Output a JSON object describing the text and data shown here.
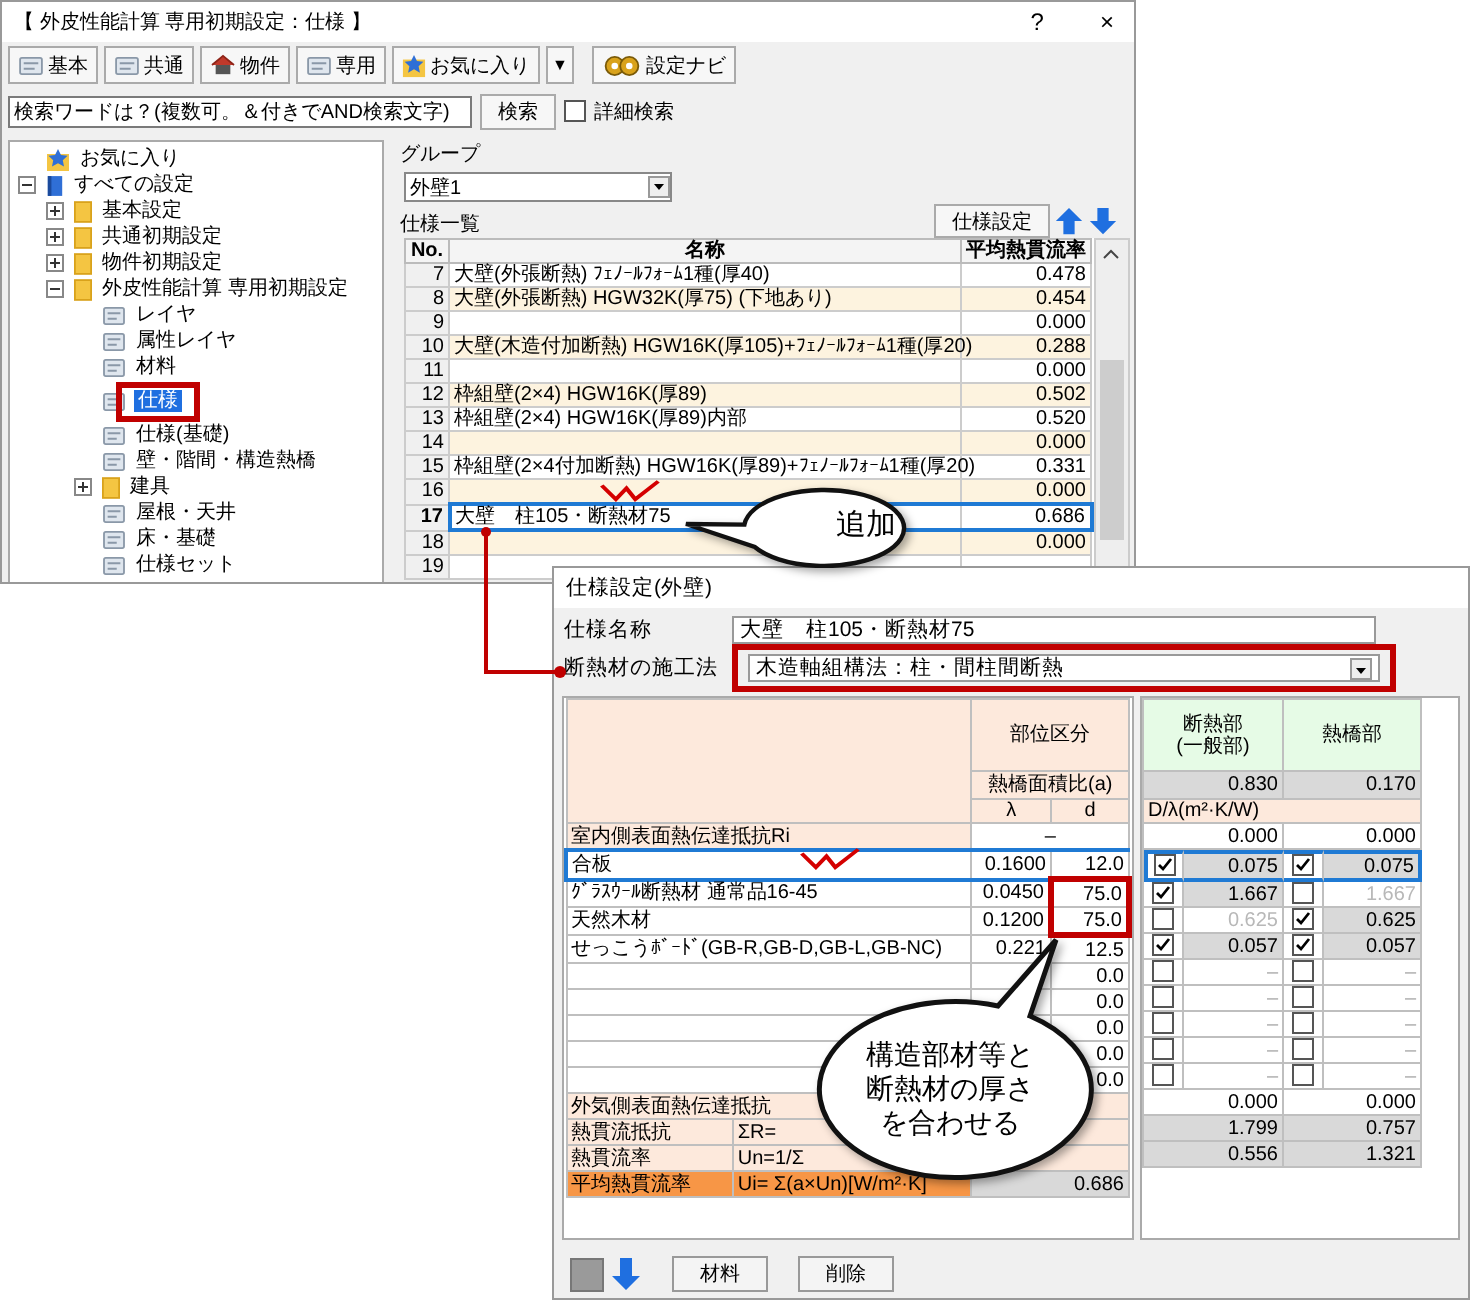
{
  "main_window": {
    "title": "【 外皮性能計算 専用初期設定：仕様 】",
    "help": "?",
    "close": "×"
  },
  "toolbar": [
    {
      "kind": "doc",
      "label": "基本"
    },
    {
      "kind": "doc",
      "label": "共通"
    },
    {
      "kind": "house",
      "label": "物件"
    },
    {
      "kind": "doc",
      "label": "専用"
    },
    {
      "kind": "star",
      "label": "お気に入り"
    },
    {
      "kind": "dropdown",
      "label": "▼"
    },
    {
      "kind": "gear",
      "label": "設定ナビ"
    }
  ],
  "search": {
    "value": "検索ワードは？(複数可。＆付きでAND検索文字)",
    "button": "検索",
    "detail_label": "詳細検索",
    "detail_checked": false
  },
  "tree": [
    {
      "kind": "star",
      "label": "お気に入り",
      "selected": false,
      "highlighted": false
    },
    {
      "kind": "book",
      "label": "すべての設定",
      "selected": false,
      "highlighted": false,
      "expanded": true,
      "children": [
        {
          "kind": "folder",
          "label": "基本設定",
          "selected": false,
          "highlighted": false,
          "expanded": false
        },
        {
          "kind": "folder",
          "label": "共通初期設定",
          "selected": false,
          "highlighted": false,
          "expanded": false
        },
        {
          "kind": "folder",
          "label": "物件初期設定",
          "selected": false,
          "highlighted": false,
          "expanded": false
        },
        {
          "kind": "folder",
          "label": "外皮性能計算 専用初期設定",
          "selected": false,
          "highlighted": false,
          "expanded": true,
          "children": [
            {
              "kind": "doc",
              "label": "レイヤ",
              "selected": false,
              "highlighted": false
            },
            {
              "kind": "doc",
              "label": "属性レイヤ",
              "selected": false,
              "highlighted": false
            },
            {
              "kind": "doc",
              "label": "材料",
              "selected": false,
              "highlighted": false
            },
            {
              "kind": "doc",
              "label": "仕様",
              "selected": true,
              "highlighted": true
            },
            {
              "kind": "doc",
              "label": "仕様(基礎)",
              "selected": false,
              "highlighted": false
            },
            {
              "kind": "doc",
              "label": "壁・階間・構造熱橋",
              "selected": false,
              "highlighted": false
            },
            {
              "kind": "folder",
              "label": "建具",
              "selected": false,
              "highlighted": false,
              "expanded": false
            },
            {
              "kind": "doc",
              "label": "屋根・天井",
              "selected": false,
              "highlighted": false
            },
            {
              "kind": "doc",
              "label": "床・基礎",
              "selected": false,
              "highlighted": false
            },
            {
              "kind": "doc",
              "label": "仕様セット",
              "selected": false,
              "highlighted": false
            }
          ]
        }
      ]
    }
  ],
  "group": {
    "label": "グループ",
    "value": "外壁1"
  },
  "spec_list": {
    "label": "仕様一覧",
    "button": "仕様設定",
    "columns": [
      "No.",
      "名称",
      "平均熱貫流率"
    ],
    "rows": [
      {
        "no": "7",
        "name": "大壁(外張断熱) ﾌｪﾉｰﾙﾌｫｰﾑ1種(厚40)",
        "value": "0.478",
        "selected": false
      },
      {
        "no": "8",
        "name": "大壁(外張断熱) HGW32K(厚75) (下地あり)",
        "value": "0.454",
        "selected": false
      },
      {
        "no": "9",
        "value": "0.000",
        "selected": false
      },
      {
        "no": "10",
        "name": "大壁(木造付加断熱) HGW16K(厚105)+ﾌｪﾉｰﾙﾌｫｰﾑ1種(厚20)",
        "value": "0.288",
        "selected": false
      },
      {
        "no": "11",
        "value": "0.000",
        "selected": false
      },
      {
        "no": "12",
        "name": "枠組壁(2×4) HGW16K(厚89)",
        "value": "0.502",
        "selected": false
      },
      {
        "no": "13",
        "name": "枠組壁(2×4) HGW16K(厚89)内部",
        "value": "0.520",
        "selected": false
      },
      {
        "no": "14",
        "value": "0.000",
        "selected": false
      },
      {
        "no": "15",
        "name": "枠組壁(2×4付加断熱) HGW16K(厚89)+ﾌｪﾉｰﾙﾌｫｰﾑ1種(厚20)",
        "value": "0.331",
        "selected": false
      },
      {
        "no": "16",
        "value": "0.000",
        "selected": false
      },
      {
        "no": "17",
        "name": "大壁　柱105・断熱材75",
        "value": "0.686",
        "selected": true
      },
      {
        "no": "18",
        "value": "0.000",
        "selected": false
      },
      {
        "no": "19",
        "selected": false
      }
    ]
  },
  "spec_window": {
    "title": "仕様設定(外壁)",
    "name_label": "仕様名称",
    "name_value": "大壁　柱105・断熱材75",
    "method_label": "断熱材の施工法",
    "method_value": "木造軸組構法：柱・間柱間断熱",
    "method_highlighted": true,
    "section_header": "部位区分",
    "area_ratio_label": "熱橋面積比(a)",
    "lambda_label": "λ",
    "d_label": "d",
    "insulated_header": [
      "断熱部",
      "(一般部)"
    ],
    "bridge_header": "熱橋部",
    "insulated_ratio": "0.830",
    "bridge_ratio": "0.170",
    "unit_label": "D/λ(m²·K/W)",
    "ri": {
      "label": "室内側表面熱伝達抵抗Ri",
      "value": "–",
      "insulated": "0.000",
      "bridge": "0.000"
    },
    "materials": [
      {
        "name": "合板",
        "lambda": "0.1600",
        "d": "12.0",
        "d_highlighted": false,
        "selected": true,
        "insulated": {
          "checked": true,
          "value": "0.075"
        },
        "bridge": {
          "checked": true,
          "value": "0.075"
        }
      },
      {
        "name": "ｸﾞﾗｽｳｰﾙ断熱材 通常品16-45",
        "lambda": "0.0450",
        "d": "75.0",
        "d_highlighted": true,
        "selected": false,
        "insulated": {
          "checked": true,
          "value": "1.667"
        },
        "bridge": {
          "checked": false,
          "value": "1.667"
        }
      },
      {
        "name": "天然木材",
        "lambda": "0.1200",
        "d": "75.0",
        "d_highlighted": true,
        "selected": false,
        "insulated": {
          "checked": false,
          "value": "0.625"
        },
        "bridge": {
          "checked": true,
          "value": "0.625"
        }
      },
      {
        "name": "せっこうﾎﾞｰﾄﾞ(GB-R,GB-D,GB-L,GB-NC)",
        "lambda": "0.221",
        "d": "12.5",
        "d_highlighted": false,
        "selected": false,
        "insulated": {
          "checked": true,
          "value": "0.057"
        },
        "bridge": {
          "checked": true,
          "value": "0.057"
        }
      },
      {
        "d": "0.0",
        "d_highlighted": false,
        "selected": false,
        "insulated": {
          "checked": false,
          "value": "–"
        },
        "bridge": {
          "checked": false,
          "value": "–"
        }
      },
      {
        "d": "0.0",
        "d_highlighted": false,
        "selected": false,
        "insulated": {
          "checked": false,
          "value": "–"
        },
        "bridge": {
          "checked": false,
          "value": "–"
        }
      },
      {
        "d": "0.0",
        "d_highlighted": false,
        "selected": false,
        "insulated": {
          "checked": false,
          "value": "–"
        },
        "bridge": {
          "checked": false,
          "value": "–"
        }
      },
      {
        "d": "0.0",
        "d_highlighted": false,
        "selected": false,
        "insulated": {
          "checked": false,
          "value": "–"
        },
        "bridge": {
          "checked": false,
          "value": "–"
        }
      },
      {
        "d": "0.0",
        "d_highlighted": false,
        "selected": false,
        "insulated": {
          "checked": false,
          "value": "–"
        },
        "bridge": {
          "checked": false,
          "value": "–"
        }
      }
    ],
    "summary": [
      {
        "kind": "plain",
        "label": "外気側表面熱伝達抵抗",
        "insulated": "0.000",
        "bridge": "0.000"
      },
      {
        "kind": "formula",
        "label": "熱貫流抵抗",
        "formula": "ΣR=",
        "insulated": "1.799",
        "bridge": "0.757"
      },
      {
        "kind": "formula",
        "label": "熱貫流率",
        "formula": "Un=1/Σ",
        "insulated": "0.556",
        "bridge": "1.321"
      },
      {
        "kind": "total",
        "label": "平均熱貫流率",
        "formula": "Ui= Σ(a×Un)[W/m²·K]",
        "total": "0.686"
      }
    ],
    "buttons": [
      "材料",
      "削除"
    ]
  },
  "callouts": [
    {
      "text": "追加"
    },
    {
      "text": "構造部材等と断熱材の厚さを合わせる"
    }
  ]
}
